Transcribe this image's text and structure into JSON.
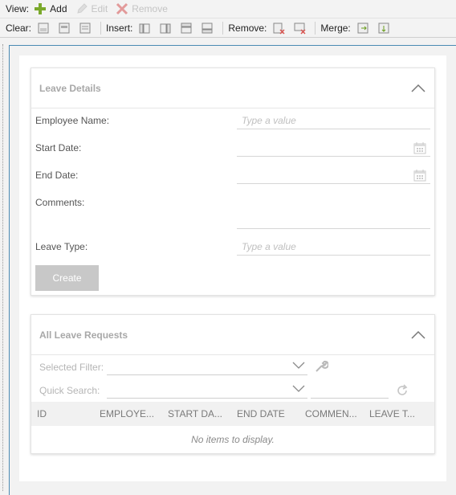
{
  "toolbar": {
    "view_label": "View:",
    "add_label": "Add",
    "edit_label": "Edit",
    "remove_label": "Remove",
    "clear_label": "Clear:",
    "insert_label": "Insert:",
    "remove_group_label": "Remove:",
    "merge_label": "Merge:"
  },
  "leave_details": {
    "title": "Leave Details",
    "fields": {
      "employee_name": {
        "label": "Employee Name:",
        "placeholder": "Type a value"
      },
      "start_date": {
        "label": "Start Date:"
      },
      "end_date": {
        "label": "End Date:"
      },
      "comments": {
        "label": "Comments:"
      },
      "leave_type": {
        "label": "Leave Type:",
        "placeholder": "Type a value"
      }
    },
    "create_label": "Create"
  },
  "all_requests": {
    "title": "All Leave Requests",
    "selected_filter_label": "Selected Filter:",
    "quick_search_label": "Quick Search:",
    "columns": [
      "ID",
      "EMPLOYE...",
      "START DA...",
      "END DATE",
      "COMMEN...",
      "LEAVE T..."
    ],
    "empty_message": "No items to display."
  },
  "colors": {
    "accent_green": "#6a9e1f",
    "remove_red": "#d9534f",
    "frame_blue": "#4a8ab3"
  }
}
